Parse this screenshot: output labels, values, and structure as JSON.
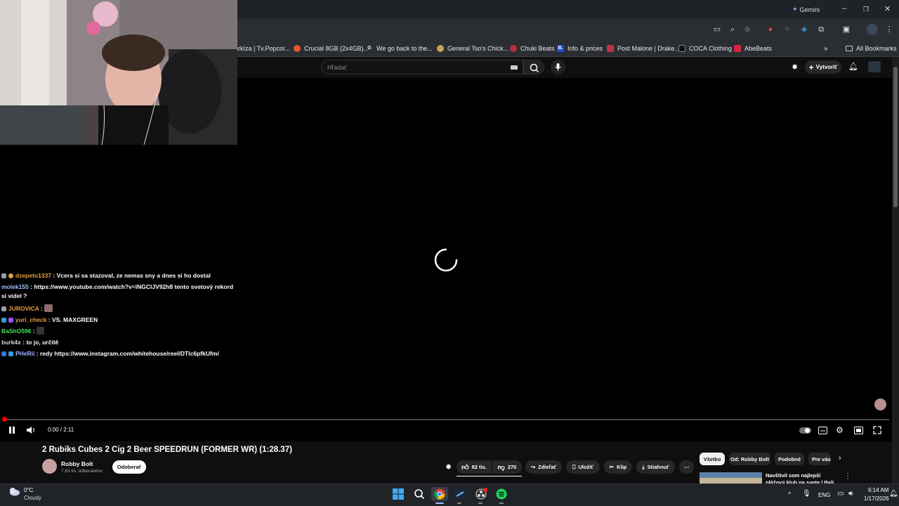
{
  "browser": {
    "gemini_label": "Gemini",
    "bookmarks": [
      {
        "label": "arkíza | Tv.Popcor...",
        "icon_color": "#2a2e33"
      },
      {
        "label": "Crucial 8GB (2x4GB)...",
        "icon_color": "#e8572a"
      },
      {
        "label": "We go back to the...",
        "icon_color": "#ffffff"
      },
      {
        "label": "General Tso's Chick...",
        "icon_color": "#c9a25a"
      },
      {
        "label": "Chuki Beats",
        "icon_color": "#b5323c"
      },
      {
        "label": "Info & prices",
        "icon_color": "#1a4fd6"
      },
      {
        "label": "Post Malone | Drake...",
        "icon_color": "#c0304a"
      },
      {
        "label": "COCA Clothing",
        "icon_color": "#111111"
      },
      {
        "label": "AbeBeats",
        "icon_color": "#d9243a"
      }
    ],
    "all_bookmarks_label": "All Bookmarks"
  },
  "youtube": {
    "search_placeholder": "Hľadať",
    "create_label": "Vytvoriť"
  },
  "chat": [
    {
      "user": "dzepeto1337",
      "user_color": "#e6a03c",
      "message": ": Vcera si sa stazoval, ze nemas sny a dnes si ho dostal",
      "badges": [
        "#9aa0a6",
        "#e6a03c"
      ]
    },
    {
      "user": "molek155",
      "user_color": "#9fc6ff",
      "message": ": https://www.youtube.com/watch?v=iNGClJV92h8 tento svetový rekord si videl ?",
      "badges": []
    },
    {
      "user": "JUROVICA",
      "user_color": "#e6a03c",
      "message": ":",
      "badges": [
        "#9aa0a6"
      ]
    },
    {
      "user": "yuri_check",
      "user_color": "#e6a03c",
      "message": ": VS. MAXGREEN",
      "badges": [
        "#3a9bd8",
        "#8a5cf6"
      ]
    },
    {
      "user": "BaShO596",
      "user_color": "#49e35a",
      "message": ":",
      "badges": []
    },
    {
      "user": "burk4x",
      "user_color": "#d6d6d6",
      "message": ": to jo, určitě",
      "badges": []
    },
    {
      "user": "PHeRii",
      "user_color": "#9fb4ff",
      "message": ": redy https://www.instagram.com/whitehouse/reel/DTlc6pfkUfm/",
      "badges": [
        "#3a6ed8",
        "#3a9bd8"
      ]
    }
  ],
  "player": {
    "time": "0:00 / 2:11",
    "progress": 0.0
  },
  "video": {
    "title": "2 Rubiks Cubes 2 Cig 2 Beer SPEEDRUN (FORMER WR) (1:28.37)",
    "channel": "Robby Bolt",
    "subscribers": "7,63 tis. odberateľov",
    "subscribe_label": "Odoberať",
    "likes": "82 tis.",
    "dislikes": "270",
    "share_label": "Zdieľať",
    "save_label": "Uložiť",
    "clip_label": "Klip",
    "download_label": "Stiahnuť"
  },
  "filter_chips": [
    "Všetko",
    "Od: Robby Bolt",
    "Podobné",
    "Pre vás"
  ],
  "recommended": {
    "title": "Navštívil som najlepší plážový klub na svete | Bali, Indonézia"
  },
  "taskbar": {
    "weather_temp": "0°C",
    "weather_desc": "Cloudy",
    "language": "ENG",
    "time": "6:14 AM",
    "date": "1/17/2026"
  }
}
